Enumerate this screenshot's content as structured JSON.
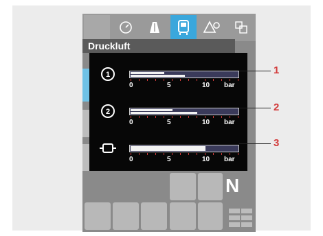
{
  "title": "Druckluft",
  "tabs": [
    {
      "icon": "blank-tab-icon",
      "active": false
    },
    {
      "icon": "gauge-icon",
      "active": false
    },
    {
      "icon": "road-icon",
      "active": false
    },
    {
      "icon": "vehicle-front-icon",
      "active": true
    },
    {
      "icon": "warning-settings-icon",
      "active": false
    },
    {
      "icon": "multi-device-icon",
      "active": false
    }
  ],
  "gauges": [
    {
      "icon": "circuit-1-icon",
      "circuit_label": "1",
      "pressure_upper": 4.0,
      "pressure_lower": 6.5,
      "callout": "1"
    },
    {
      "icon": "circuit-2-icon",
      "circuit_label": "2",
      "pressure_upper": 5.0,
      "pressure_lower": 8.0,
      "callout": "2"
    },
    {
      "icon": "reservoir-icon",
      "pressure": 9.0,
      "callout": "3"
    }
  ],
  "scale": {
    "labels": [
      "0",
      "5",
      "10"
    ],
    "max": 13,
    "unit": "bar"
  },
  "gear": "N",
  "colors": {
    "accent": "#3aa7dc",
    "tick": "#d23a3a",
    "callout": "#d23a3a"
  }
}
